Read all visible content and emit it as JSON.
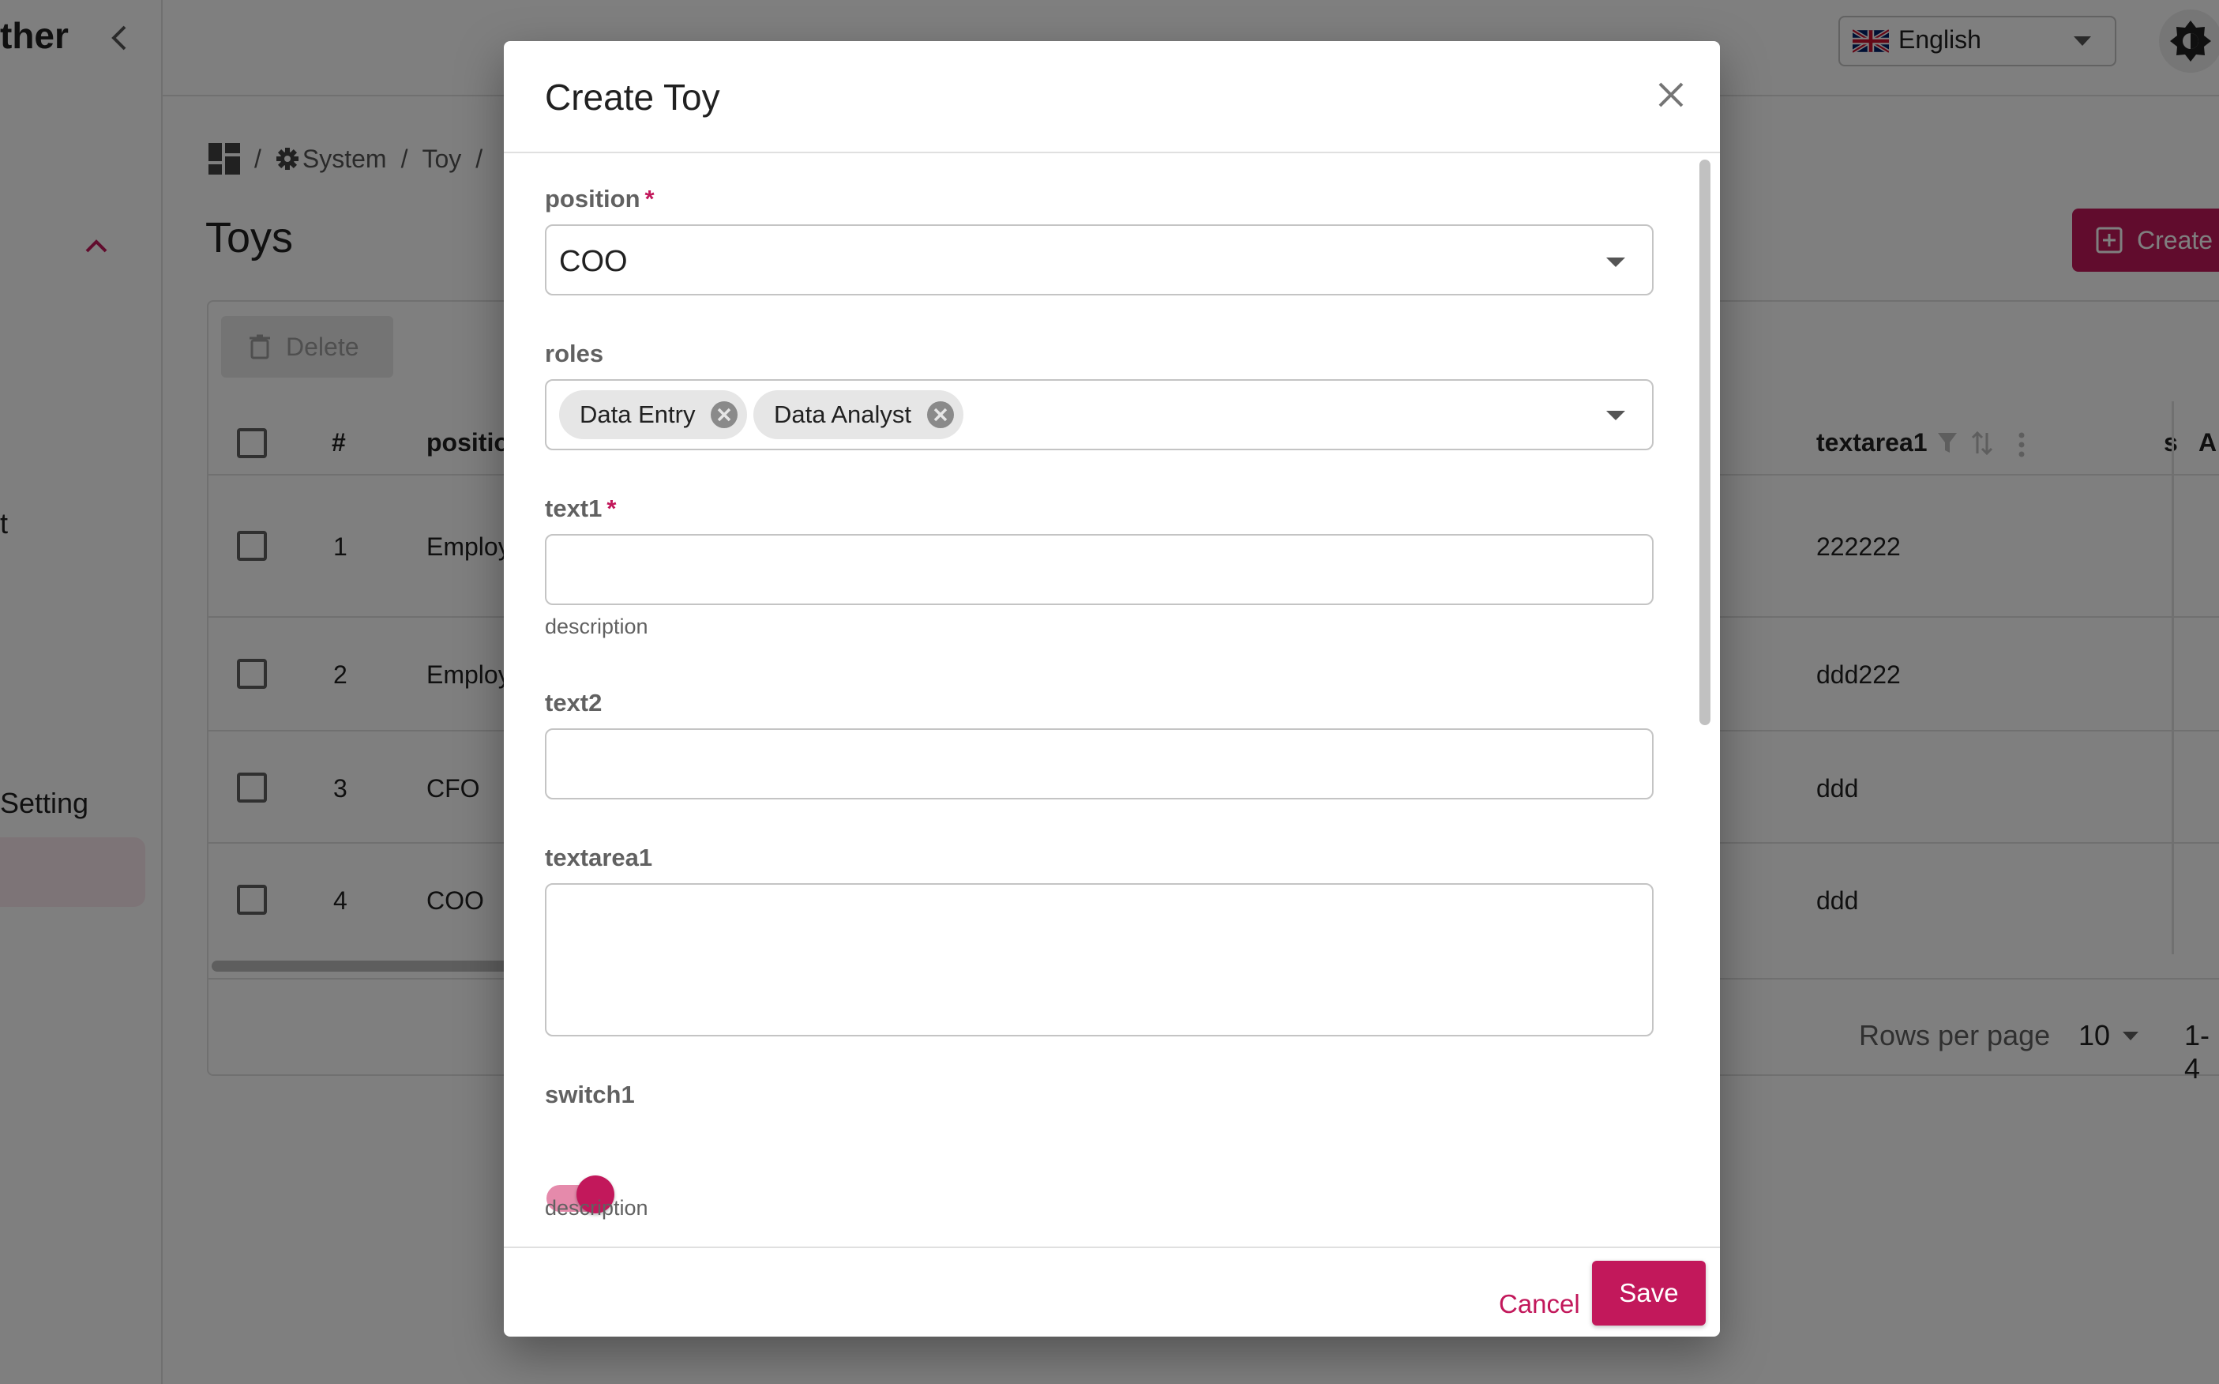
{
  "app": {
    "brand_fragment": "ther"
  },
  "sidebar": {
    "item_t": "t",
    "item_setting": "Setting"
  },
  "topbar": {
    "language": "English"
  },
  "breadcrumb": {
    "system": "System",
    "toy": "Toy",
    "sep": "/"
  },
  "page": {
    "title": "Toys",
    "create_label": "Create",
    "delete_label": "Delete"
  },
  "table": {
    "headers": {
      "index": "#",
      "position": "positio",
      "textarea1": "textarea1",
      "s": "s",
      "a": "A"
    },
    "rows": [
      {
        "index": "1",
        "position": "Employ",
        "textarea1": "222222"
      },
      {
        "index": "2",
        "position": "Employ",
        "textarea1": "ddd222"
      },
      {
        "index": "3",
        "position": "CFO",
        "textarea1": "ddd"
      },
      {
        "index": "4",
        "position": "COO",
        "textarea1": "ddd"
      }
    ],
    "footer": {
      "rows_per_page_label": "Rows per page",
      "rows_per_page": "10",
      "range": "1-4"
    }
  },
  "dialog": {
    "title": "Create Toy",
    "fields": {
      "position": {
        "label": "position",
        "value": "COO",
        "required": true
      },
      "roles": {
        "label": "roles",
        "chips": [
          "Data Entry",
          "Data Analyst"
        ]
      },
      "text1": {
        "label": "text1",
        "value": "",
        "helper": "description",
        "required": true
      },
      "text2": {
        "label": "text2",
        "value": ""
      },
      "textarea1": {
        "label": "textarea1",
        "value": ""
      },
      "switch1": {
        "label": "switch1",
        "checked": true,
        "helper": "description"
      }
    },
    "required_marker": "*",
    "cancel_label": "Cancel",
    "save_label": "Save"
  },
  "colors": {
    "accent": "#c2185b",
    "backdrop": "rgba(0,0,0,0.5)"
  }
}
